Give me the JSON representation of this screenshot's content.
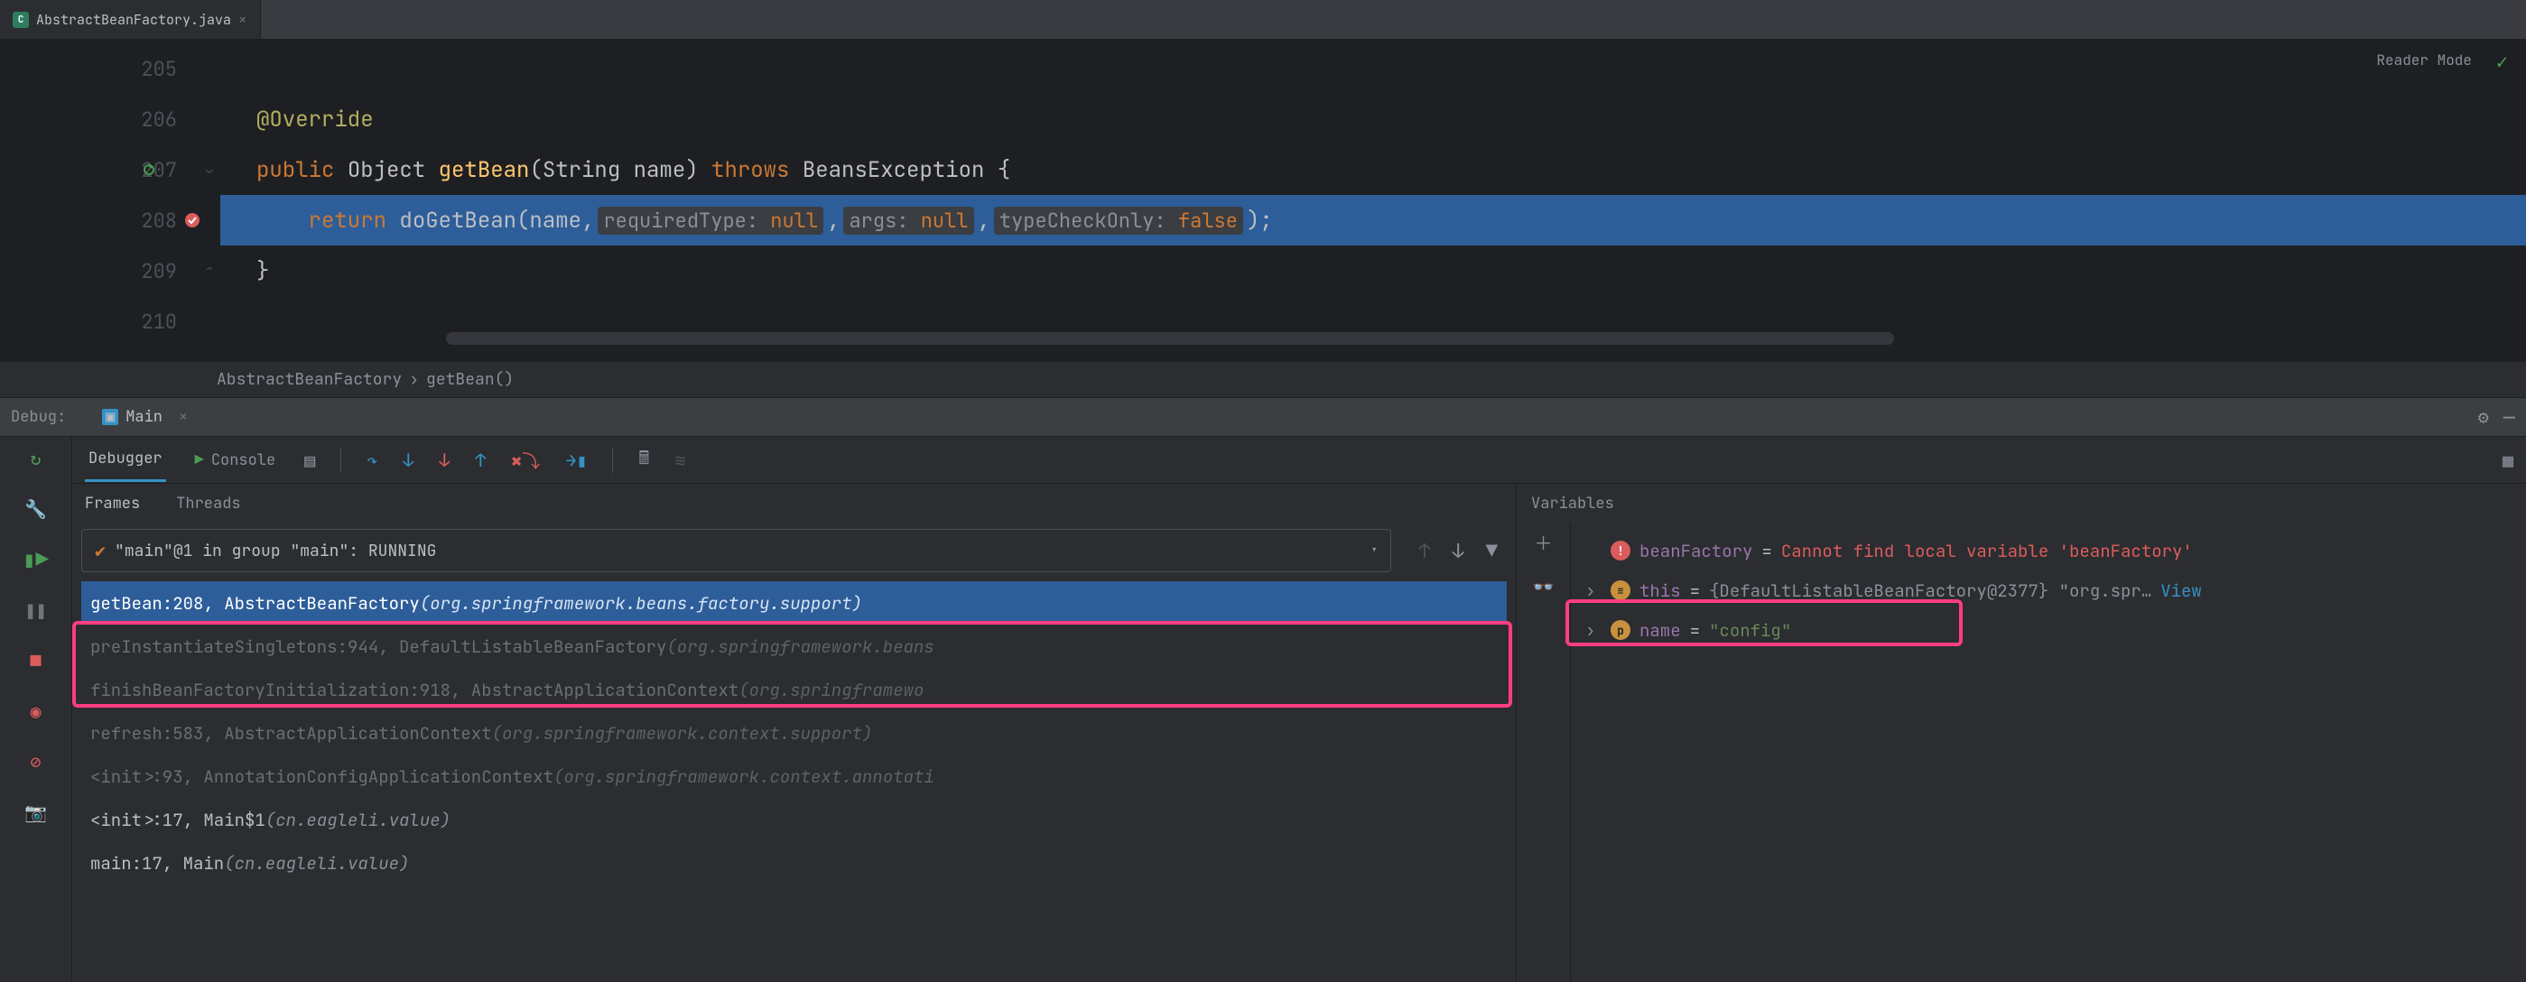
{
  "tab": {
    "filename": "AbstractBeanFactory.java",
    "icon_letter": "C"
  },
  "editor": {
    "reader_mode": "Reader Mode",
    "lines": [
      {
        "n": "205"
      },
      {
        "n": "206"
      },
      {
        "n": "207"
      },
      {
        "n": "208"
      },
      {
        "n": "209"
      },
      {
        "n": "210"
      }
    ],
    "code": {
      "override": "@Override",
      "public": "public",
      "object": "Object",
      "getBean": "getBean",
      "params": "(String name)",
      "throws": "throws",
      "exc": "BeansException {",
      "return": "return",
      "call": "doGetBean",
      "arg_name": "(name,",
      "hint1_k": "requiredType:",
      "hint1_v": "null",
      "comma1": ",",
      "hint2_k": "args:",
      "hint2_v": "null",
      "comma2": ",",
      "hint3_k": "typeCheckOnly:",
      "hint3_v": "false",
      "tail": ");",
      "close": "}"
    }
  },
  "breadcrumb": {
    "a": "AbstractBeanFactory",
    "sep": "›",
    "b": "getBean()"
  },
  "toolwindow": {
    "label": "Debug:",
    "config": "Main"
  },
  "debug_tabs": {
    "debugger": "Debugger",
    "console": "Console"
  },
  "sub_tabs": {
    "frames": "Frames",
    "threads": "Threads"
  },
  "thread": {
    "text": "\"main\"@1 in group \"main\": RUNNING"
  },
  "frames": [
    {
      "m": "getBean:208, AbstractBeanFactory ",
      "p": "(org.springframework.beans.factory.support)",
      "sel": true
    },
    {
      "m": "preInstantiateSingletons:944, DefaultListableBeanFactory ",
      "p": "(org.springframework.beans",
      "lib": true
    },
    {
      "m": "finishBeanFactoryInitialization:918, AbstractApplicationContext ",
      "p": "(org.springframewo",
      "lib": true
    },
    {
      "m": "refresh:583, AbstractApplicationContext ",
      "p": "(org.springframework.context.support)",
      "lib": true
    },
    {
      "m": "<init>:93, AnnotationConfigApplicationContext ",
      "p": "(org.springframework.context.annotati",
      "lib": true
    },
    {
      "m": "<init>:17, Main$1 ",
      "p": "(cn.eagleli.value)"
    },
    {
      "m": "main:17, Main ",
      "p": "(cn.eagleli.value)"
    }
  ],
  "vars_header": "Variables",
  "vars": [
    {
      "icon": "err",
      "k": "beanFactory",
      "msg": "Cannot find local variable 'beanFactory'"
    },
    {
      "icon": "obj",
      "arr": true,
      "k": "this",
      "val": "{DefaultListableBeanFactory@2377} \"org.spr…",
      "view": "View"
    },
    {
      "icon": "p",
      "arr": true,
      "k": "name",
      "str": "\"config\""
    }
  ],
  "icons": {
    "rerun": "↻",
    "wrench": "🔧",
    "resume": "▶",
    "pause": "❚❚",
    "stop": "■",
    "bp": "●",
    "mute": "⃠",
    "camera": "📷",
    "step_over": "⤵",
    "step_into": "↧",
    "force_into": "↧",
    "step_out": "↥",
    "drop": "✖↘",
    "run_to": "▶❘",
    "eval": "🖩",
    "trace": "≋",
    "gear": "⚙",
    "minimize": "—",
    "plus": "＋",
    "glasses": "👓",
    "layout": "▦",
    "up": "↑",
    "down": "↓",
    "filter": "⧩"
  }
}
